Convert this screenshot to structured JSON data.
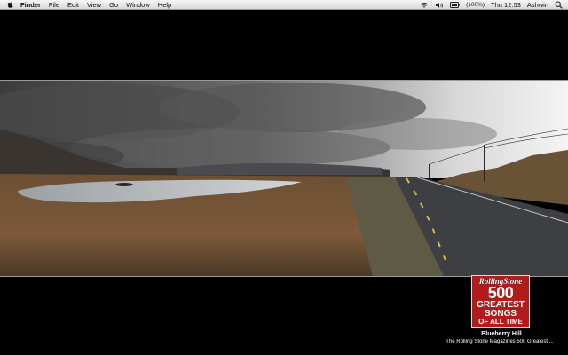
{
  "menubar": {
    "app_name": "Finder",
    "items": [
      "File",
      "Edit",
      "View",
      "Go",
      "Window",
      "Help"
    ],
    "battery": "(100%)",
    "clock": "Thu 12:53",
    "user": "Ashwin",
    "icons": [
      "apple-icon",
      "wifi-icon",
      "volume-icon",
      "battery-icon",
      "spotlight-icon"
    ]
  },
  "now_playing": {
    "album_art": {
      "brand": "RollingStone",
      "number": "500",
      "line1": "GREATEST",
      "line2": "SONGS",
      "line3": "OF ALL TIME"
    },
    "title": "Blueberry Hill",
    "album": "The Rolling Stone Magazines 500 Greatest ..."
  },
  "colors": {
    "background": "#000000",
    "album_red": "#b01c1c"
  }
}
